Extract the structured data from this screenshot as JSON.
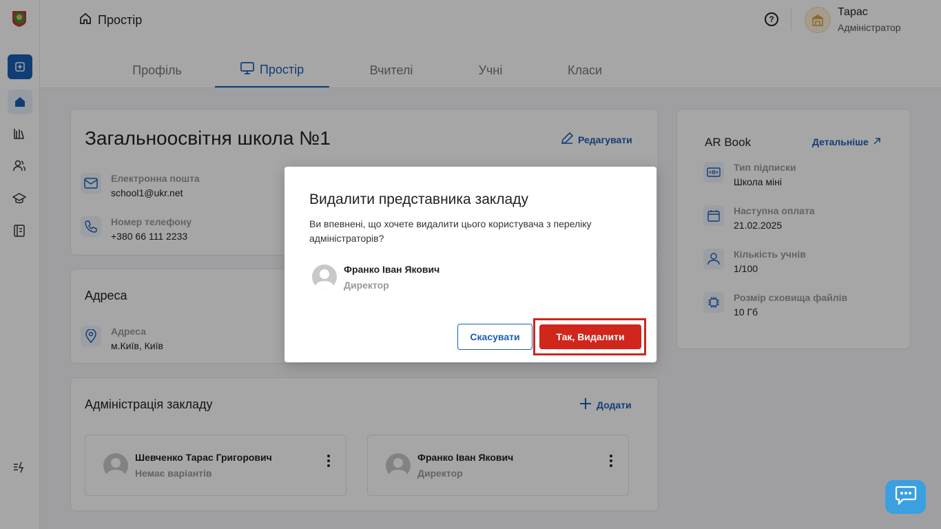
{
  "header": {
    "breadcrumb": "Простір",
    "help_icon": "?",
    "user": {
      "name": "Тарас",
      "role": "Адміністратор"
    }
  },
  "tabs": [
    {
      "label": "Профіль",
      "active": false
    },
    {
      "label": "Простір",
      "active": true
    },
    {
      "label": "Вчителі",
      "active": false
    },
    {
      "label": "Учні",
      "active": false
    },
    {
      "label": "Класи",
      "active": false
    }
  ],
  "school": {
    "title": "Загальноосвітня школа №1",
    "edit_label": "Редагувати",
    "email_label": "Електронна пошта",
    "email_value": "school1@ukr.net",
    "phone_label": "Номер телефону",
    "phone_value": "+380 66 111 2233"
  },
  "address": {
    "title": "Адреса",
    "label": "Адреса",
    "value": "м.Київ, Київ"
  },
  "administration": {
    "title": "Адміністрація закладу",
    "add_label": "Додати",
    "admins": [
      {
        "name": "Шевченко Тарас Григорович",
        "role": "Немає варіантів"
      },
      {
        "name": "Франко Іван Якович",
        "role": "Директор"
      }
    ]
  },
  "subscription": {
    "title": "AR Book",
    "details_label": "Детальніше",
    "items": [
      {
        "label": "Тип підписки",
        "value": "Школа міні"
      },
      {
        "label": "Наступна оплата",
        "value": "21.02.2025"
      },
      {
        "label": "Кількість учнів",
        "value": "1/100"
      },
      {
        "label": "Розмір сховища файлів",
        "value": "10 Гб"
      }
    ]
  },
  "modal": {
    "title": "Видалити представника закладу",
    "text": "Ви впевнені, що хочете видалити цього користувача з переліку адміністраторів?",
    "user_name": "Франко Іван Якович",
    "user_role": "Директор",
    "cancel_label": "Скасувати",
    "confirm_label": "Так, Видалити"
  },
  "colors": {
    "accent": "#1a5fb4",
    "danger": "#d0261c",
    "chat": "#3aa0e0"
  }
}
